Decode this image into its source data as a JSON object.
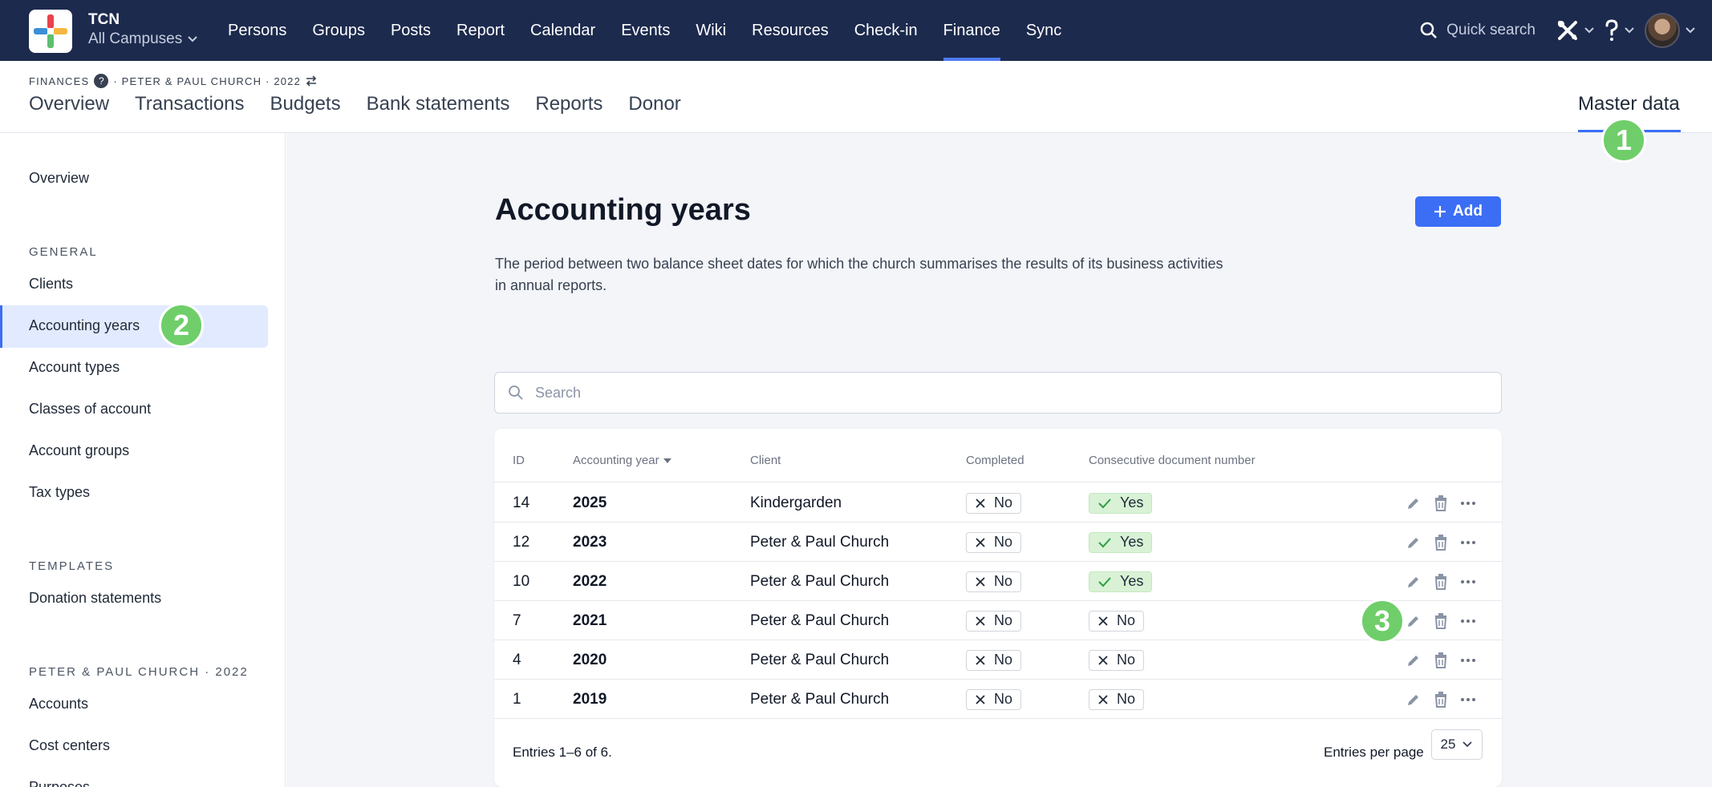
{
  "app": {
    "org_name": "TCN",
    "campus": "All Campuses",
    "nav": [
      "Persons",
      "Groups",
      "Posts",
      "Report",
      "Calendar",
      "Events",
      "Wiki",
      "Resources",
      "Check-in",
      "Finance",
      "Sync"
    ],
    "active_nav": "Finance",
    "quick_search": "Quick search"
  },
  "subheader": {
    "crumb_section": "FINANCES",
    "crumb_help": "?",
    "crumb_context": "· PETER & PAUL CHURCH · 2022",
    "tabs": [
      "Overview",
      "Transactions",
      "Budgets",
      "Bank statements",
      "Reports",
      "Donor"
    ],
    "master_data": "Master data"
  },
  "sidebar": {
    "overview": "Overview",
    "general_heading": "GENERAL",
    "general_items": [
      "Clients",
      "Accounting years",
      "Account types",
      "Classes of account",
      "Account groups",
      "Tax types"
    ],
    "active_item": "Accounting years",
    "templates_heading": "TEMPLATES",
    "templates_items": [
      "Donation statements"
    ],
    "church_heading": "PETER & PAUL CHURCH · 2022",
    "church_items": [
      "Accounts",
      "Cost centers",
      "Purposes"
    ]
  },
  "page": {
    "title": "Accounting years",
    "add_label": "Add",
    "description": "The period between two balance sheet dates for which the church summarises the results of its business activities in annual reports.",
    "search_placeholder": "Search"
  },
  "table": {
    "columns": [
      "ID",
      "Accounting year",
      "Client",
      "Completed",
      "Consecutive document number"
    ],
    "rows": [
      {
        "id": "14",
        "year": "2025",
        "client": "Kindergarden",
        "completed": "No",
        "consecutive": "Yes"
      },
      {
        "id": "12",
        "year": "2023",
        "client": "Peter & Paul Church",
        "completed": "No",
        "consecutive": "Yes"
      },
      {
        "id": "10",
        "year": "2022",
        "client": "Peter & Paul Church",
        "completed": "No",
        "consecutive": "Yes"
      },
      {
        "id": "7",
        "year": "2021",
        "client": "Peter & Paul Church",
        "completed": "No",
        "consecutive": "No"
      },
      {
        "id": "4",
        "year": "2020",
        "client": "Peter & Paul Church",
        "completed": "No",
        "consecutive": "No"
      },
      {
        "id": "1",
        "year": "2019",
        "client": "Peter & Paul Church",
        "completed": "No",
        "consecutive": "No"
      }
    ],
    "entries_text": "Entries 1–6 of 6.",
    "per_page_label": "Entries per page",
    "per_page_value": "25"
  },
  "markers": [
    "1",
    "2",
    "3"
  ],
  "colors": {
    "nav_bg": "#1c2a4d",
    "accent": "#3b6ef5",
    "marker": "#6fce6a",
    "yes_bg": "#d9f2d6"
  }
}
